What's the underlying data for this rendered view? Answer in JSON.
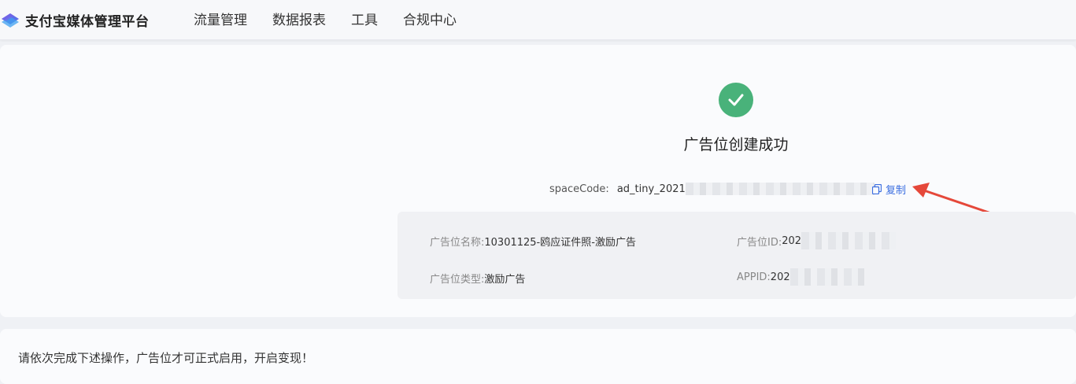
{
  "header": {
    "brand": "支付宝媒体管理平台",
    "nav": [
      "流量管理",
      "数据报表",
      "工具",
      "合规中心"
    ]
  },
  "result": {
    "icon": "check-circle-icon",
    "title": "广告位创建成功",
    "space_code_label": "spaceCode:",
    "space_code_value": "ad_tiny_2021",
    "copy_icon": "copy-icon",
    "copy_label": "复制"
  },
  "ad_info": {
    "name_label": "广告位名称:",
    "name_value": "10301125-鸥应证件照-激励广告",
    "id_label": "广告位ID:",
    "id_value": "202",
    "type_label": "广告位类型:",
    "type_value": "激励广告",
    "appid_label": "APPID:",
    "appid_value": "202"
  },
  "notice": "请依次完成下述操作，广告位才可正式启用，开启变现！",
  "colors": {
    "success": "#49b27a",
    "link": "#3b6ee0",
    "annotation_arrow": "#e5483a"
  }
}
